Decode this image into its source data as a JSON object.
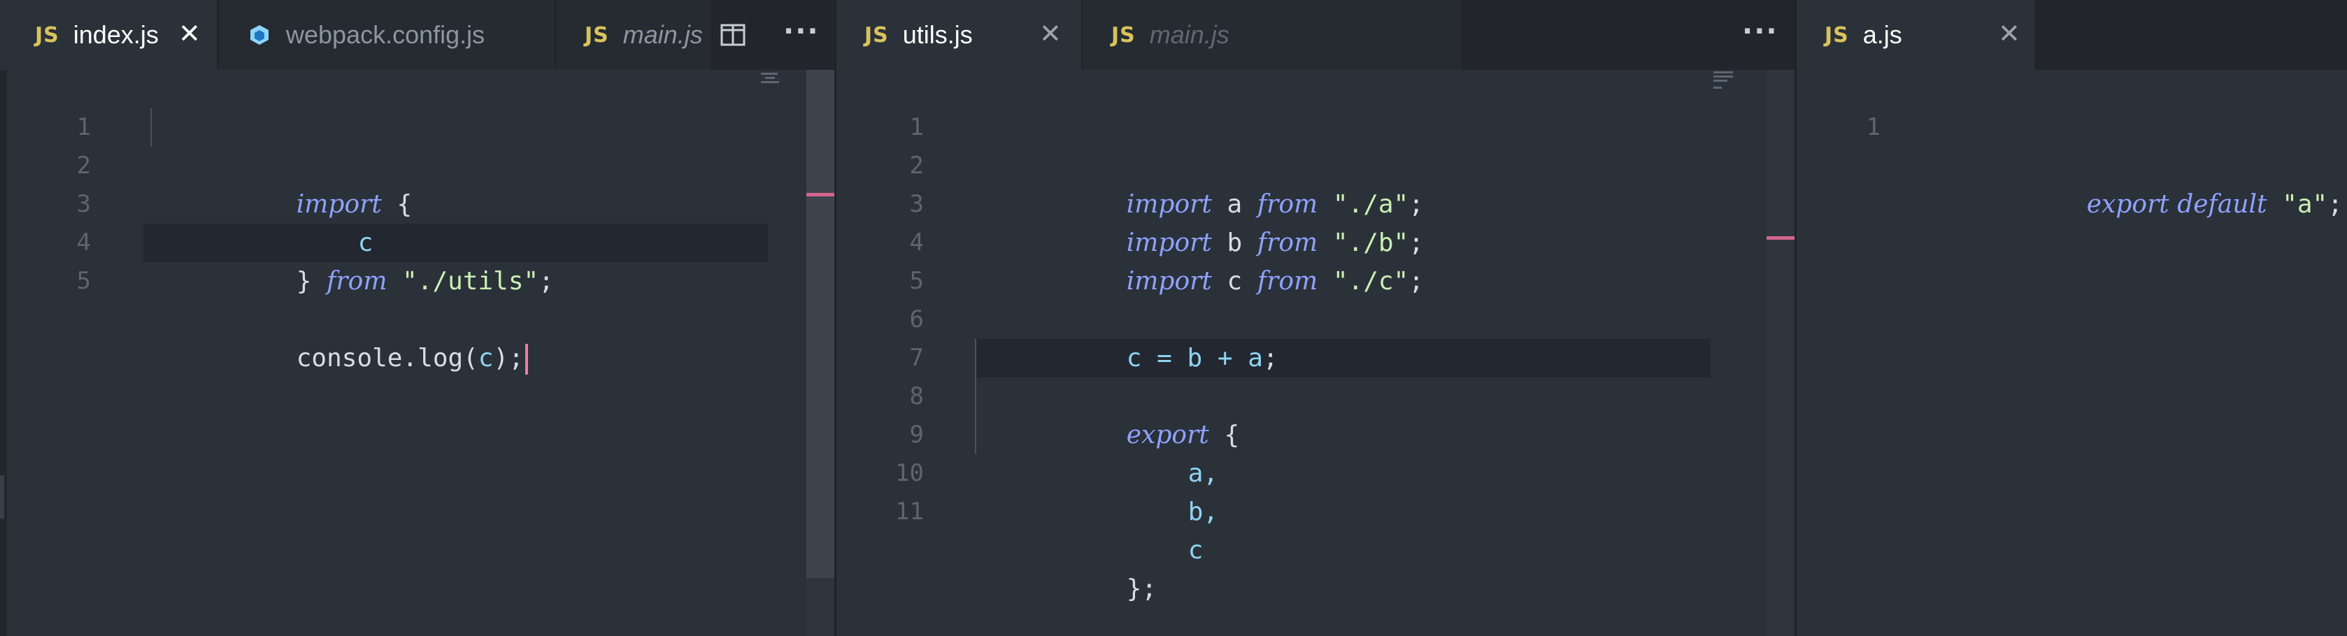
{
  "panes": {
    "left": {
      "tabs": [
        {
          "label": "index.js",
          "type": "JS",
          "active": true,
          "close": "✕"
        },
        {
          "label": "webpack.config.js",
          "type": "webpack"
        },
        {
          "label": "main.js",
          "type": "JS",
          "italic": true
        }
      ],
      "lines": [
        {
          "num": "1"
        },
        {
          "num": "2"
        },
        {
          "num": "3"
        },
        {
          "num": "4"
        },
        {
          "num": "5"
        }
      ]
    },
    "middle": {
      "tabs": [
        {
          "label": "utils.js",
          "type": "JS",
          "active": true,
          "close": "✕"
        },
        {
          "label": "main.js",
          "type": "JS",
          "italic": true
        }
      ],
      "lines": [
        {
          "num": "1"
        },
        {
          "num": "2"
        },
        {
          "num": "3"
        },
        {
          "num": "4"
        },
        {
          "num": "5"
        },
        {
          "num": "6"
        },
        {
          "num": "7"
        },
        {
          "num": "8"
        },
        {
          "num": "9"
        },
        {
          "num": "10"
        },
        {
          "num": "11"
        }
      ]
    },
    "right": {
      "tabs": [
        {
          "label": "a.js",
          "type": "JS",
          "active": true,
          "close": "✕"
        }
      ],
      "lines": [
        {
          "num": "1"
        }
      ]
    }
  },
  "code": {
    "left": {
      "l1_kw": "import",
      "l1_rest": " {",
      "l2": "c",
      "l3_open": "} ",
      "l3_kw": "from",
      "l3_str": " \"./utils\"",
      "l3_end": ";",
      "l5_a": "console.log(",
      "l5_b": "c",
      "l5_c": ");"
    },
    "middle": {
      "l1_kw": "import",
      "l1_id": " a ",
      "l1_kw2": "from",
      "l1_str": " \"./a\"",
      "l1_end": ";",
      "l2_kw": "import",
      "l2_id": " b ",
      "l2_kw2": "from",
      "l2_str": " \"./b\"",
      "l2_end": ";",
      "l3_kw": "import",
      "l3_id": " c ",
      "l3_kw2": "from",
      "l3_str": " \"./c\"",
      "l3_end": ";",
      "l5_a": "c",
      "l5_op1": " = ",
      "l5_b": "b",
      "l5_op2": " + ",
      "l5_c": "a",
      "l5_end": ";",
      "l7_kw": "export",
      "l7_rest": " {",
      "l8": "a,",
      "l9": "b,",
      "l10": "c",
      "l11": "};"
    },
    "right": {
      "l1_kw": "export",
      "l1_kw2": " default",
      "l1_str": " \"a\"",
      "l1_end": ";"
    }
  },
  "icons": {
    "js": "JS",
    "more": "···"
  },
  "colors": {
    "keyword": "#8ea2ff",
    "string": "#c9f0b4",
    "identifier": "#8fd4f3",
    "cursor": "#f07aa7",
    "js_badge": "#d8c35d"
  }
}
